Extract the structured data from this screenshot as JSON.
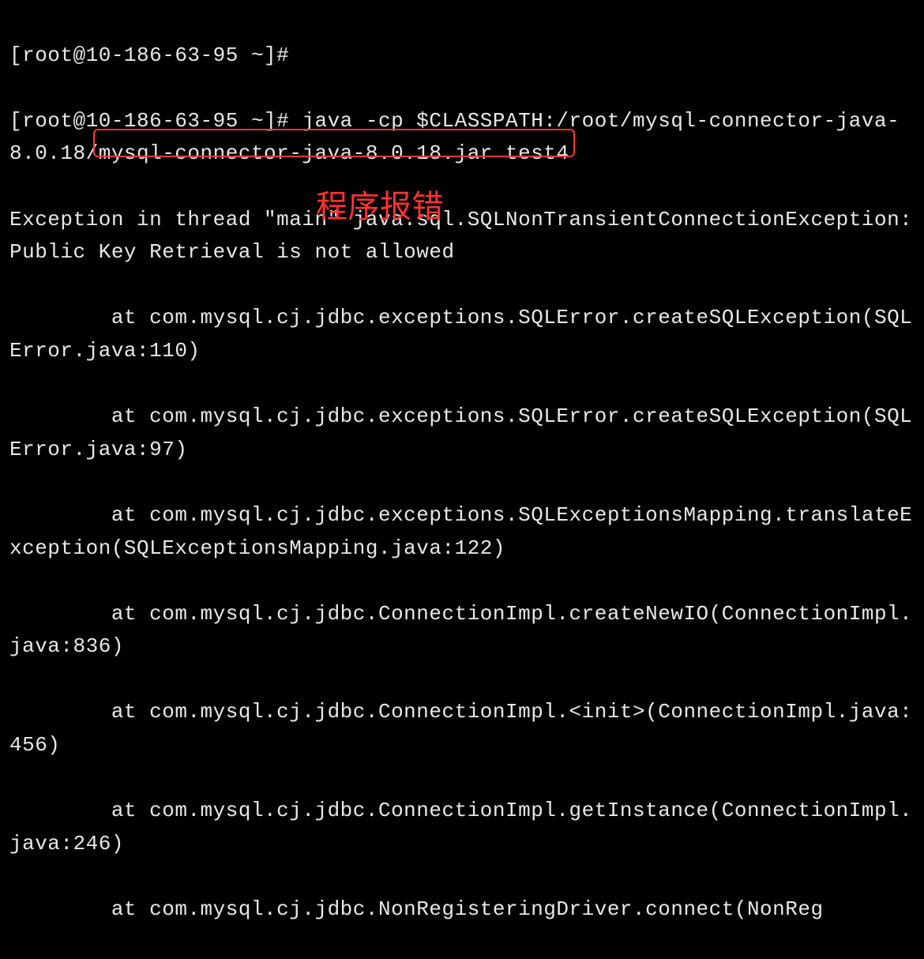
{
  "terminal": {
    "prompt1": "[root@10-186-63-95 ~]# ",
    "prompt2": "[root@10-186-63-95 ~]# ",
    "command": "java -cp $CLASSPATH:/root/mysql-connector-java-8.0.18/mysql-connector-java-8.0.18.jar test4",
    "exception_prefix": "Exception in thread \"main\" java.sql.SQLNonTransientConnectionException: ",
    "exception_msg": "Public Key Retrieval is not allowed",
    "stack1": "        at com.mysql.cj.jdbc.exceptions.SQLError.createSQLException(SQLError.java:110)",
    "stack2": "        at com.mysql.cj.jdbc.exceptions.SQLError.createSQLException(SQLError.java:97)",
    "stack3": "        at com.mysql.cj.jdbc.exceptions.SQLExceptionsMapping.translateException(SQLExceptionsMapping.java:122)",
    "stack4": "        at com.mysql.cj.jdbc.ConnectionImpl.createNewIO(ConnectionImpl.java:836)",
    "stack5": "        at com.mysql.cj.jdbc.ConnectionImpl.<init>(ConnectionImpl.java:456)",
    "stack6": "        at com.mysql.cj.jdbc.ConnectionImpl.getInstance(ConnectionImpl.java:246)",
    "stack7": "        at com.mysql.cj.jdbc.NonRegisteringDriver.connect(NonReg"
  },
  "annotation": {
    "label": "程序报错"
  }
}
